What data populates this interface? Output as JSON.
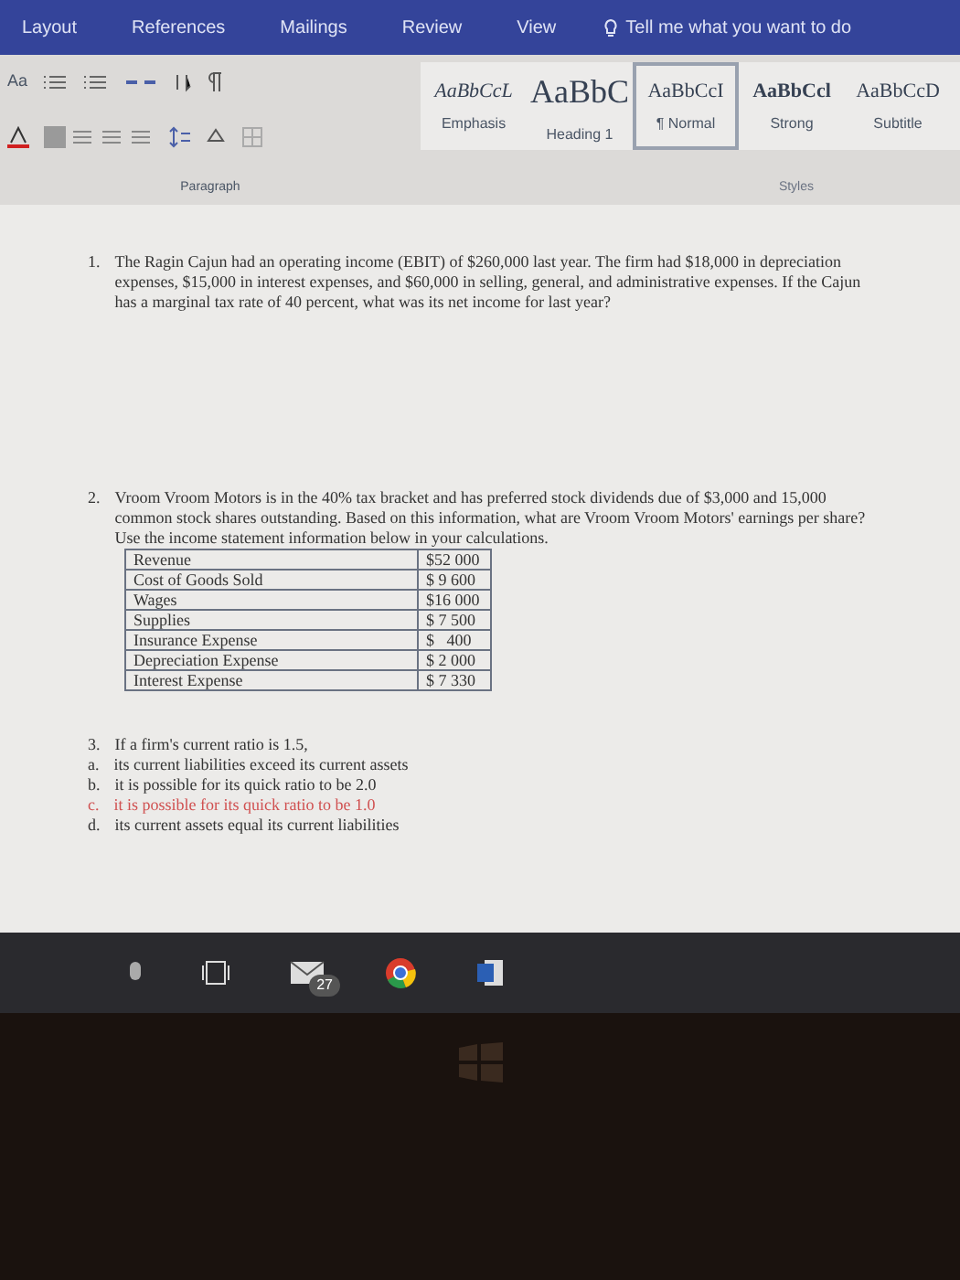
{
  "ribbon_tabs": [
    {
      "label": "Layout",
      "selected": false
    },
    {
      "label": "References",
      "selected": false
    },
    {
      "label": "Mailings",
      "selected": false
    },
    {
      "label": "Review",
      "selected": false
    },
    {
      "label": "View",
      "selected": false
    }
  ],
  "tell_me": {
    "placeholder": "Tell me what you want to do"
  },
  "font_size_label": "Aa",
  "styles": [
    {
      "sample": "AaBbCcL",
      "label": "Emphasis",
      "kind": "italic",
      "selected": false
    },
    {
      "sample": "AaBbC",
      "label": "Heading 1",
      "kind": "heading",
      "selected": false
    },
    {
      "sample": "AaBbCcI",
      "label": "¶ Normal",
      "kind": "normal",
      "selected": true
    },
    {
      "sample": "AaBbCcl",
      "label": "Strong",
      "kind": "bold",
      "selected": false
    },
    {
      "sample": "AaBbCcD",
      "label": "Subtitle",
      "kind": "subtitle",
      "selected": false
    }
  ],
  "group_labels": {
    "paragraph": "Paragraph",
    "styles": "Styles"
  },
  "questions": [
    {
      "number": "1.",
      "text": "The Ragin Cajun had an operating income (EBIT) of $260,000 last year. The firm had $18,000 in depreciation expenses, $15,000 in interest expenses, and $60,000 in selling, general, and administrative expenses. If the Cajun has a marginal tax rate of 40 percent, what was its net income for last year?"
    },
    {
      "number": "2.",
      "text": "Vroom Vroom Motors is in the 40% tax bracket and has preferred stock dividends due of $3,000 and 15,000 common stock shares outstanding. Based on this information, what are Vroom Vroom Motors' earnings per share? Use the income statement information below in your calculations.",
      "table": [
        [
          "Revenue",
          "$52 000"
        ],
        [
          "Cost of Goods Sold",
          "$ 9 600"
        ],
        [
          "Wages",
          "$16 000"
        ],
        [
          "Supplies",
          "$ 7 500"
        ],
        [
          "Insurance Expense",
          "$   400"
        ],
        [
          "Depreciation Expense",
          "$ 2 000"
        ],
        [
          "Interest Expense",
          "$ 7 330"
        ]
      ]
    },
    {
      "number": "3.",
      "text": "If a firm's current ratio is 1.5,",
      "options": [
        {
          "letter": "a.",
          "text": "its current liabilities exceed its current assets",
          "color": "#333333"
        },
        {
          "letter": "b.",
          "text": "it is possible for its quick ratio to be 2.0",
          "color": "#333333"
        },
        {
          "letter": "c.",
          "text": "it is possible for its quick ratio to be 1.0",
          "color": "#d05050"
        },
        {
          "letter": "d.",
          "text": "its current assets equal its current liabilities",
          "color": "#333333"
        }
      ]
    }
  ],
  "taskbar": {
    "mail_badge": "27"
  }
}
